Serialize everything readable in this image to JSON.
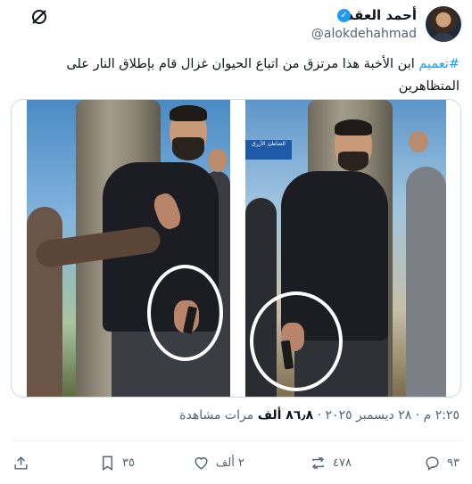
{
  "author": {
    "display_name": "أحمد العقدة",
    "handle": "@alokdehahmad",
    "verified": true
  },
  "tweet": {
    "hashtag": "#تعميم",
    "text": " ابن الأخبة هذا مرتزق من اتباع الحيوان غزال قام بإطلاق النار على المتظاهرين"
  },
  "media": {
    "left_photo_sign": "",
    "right_photo_sign": "الشاطئ الأزرق"
  },
  "meta": {
    "time": "٢:٢٥ م",
    "separator": "·",
    "date": "٢٨ ديسمبر ٢٠٢٥",
    "views_count": "٨٦٫٨ ألف",
    "views_label": "مرات مشاهدة"
  },
  "actions": {
    "replies": "٩٣",
    "reposts": "٤٧٨",
    "likes": "٢ ألف",
    "bookmarks": "٣٥"
  },
  "icons": {
    "grok": "grok-icon",
    "reply": "reply-icon",
    "repost": "repost-icon",
    "like": "heart-icon",
    "bookmark": "bookmark-icon",
    "share": "share-icon"
  },
  "colors": {
    "accent": "#1d9bf0",
    "text": "#0f1419",
    "secondary": "#536471"
  }
}
